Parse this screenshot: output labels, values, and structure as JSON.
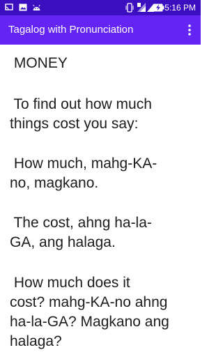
{
  "status_bar": {
    "time": "5:16 PM",
    "left_icons": [
      "cast-icon",
      "image-icon",
      "android-icon"
    ],
    "right_icons": [
      "vibrate-icon",
      "sim-signal-icon",
      "signal-icon",
      "battery-charging-icon"
    ]
  },
  "app_bar": {
    "title": "Tagalog with Pronunciation",
    "menu_icon": "overflow-menu-icon"
  },
  "content": {
    "heading": " MONEY",
    "paragraphs": [
      " To find out how much\nthings cost you say:",
      " How much, mahg-KA-\nno, magkano.",
      " The cost, ahng ha-la-\nGA, ang halaga.",
      " How much does it\ncost? mahg-KA-no ahng\nha-la-GA? Magkano ang\nhalaga?"
    ]
  },
  "colors": {
    "status_bar": "#3b0ec0",
    "app_bar": "#6425f4",
    "text": "#1c1c1c"
  }
}
